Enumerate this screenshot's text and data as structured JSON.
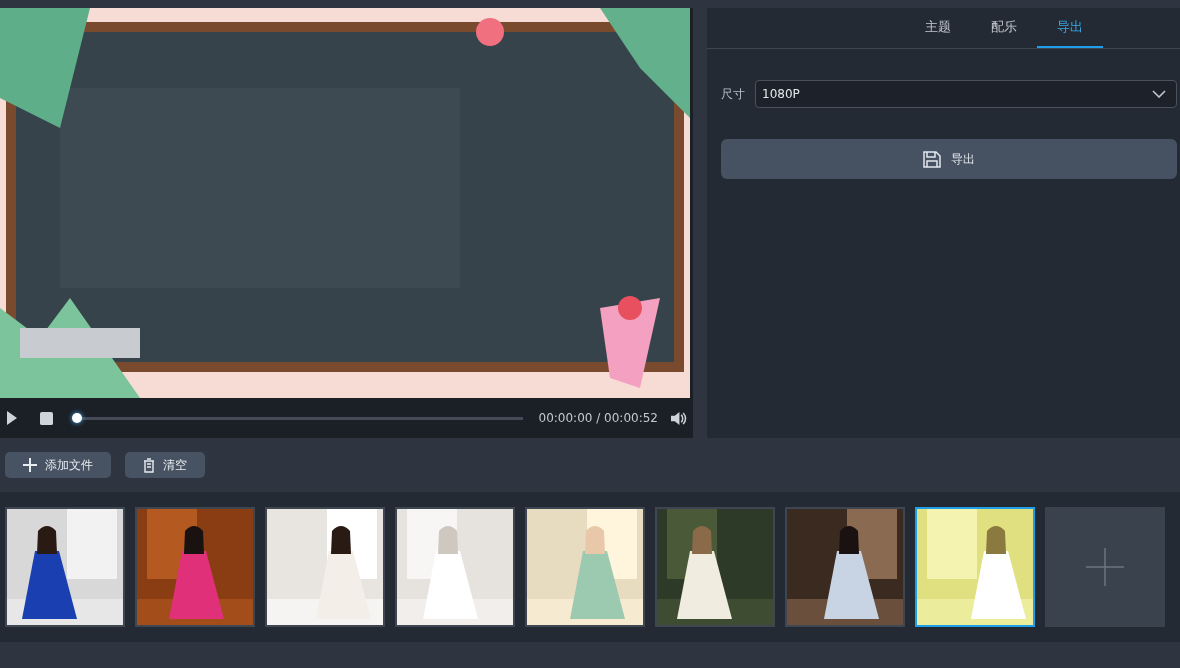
{
  "preview": {
    "kind": "picture"
  },
  "player": {
    "level": 0,
    "time": "00:00:00 / 00:00:52"
  },
  "tabs": [
    {
      "label": "主题",
      "selected": false
    },
    {
      "label": "配乐",
      "selected": false
    },
    {
      "label": "导出",
      "selected": true
    }
  ],
  "size": {
    "label": "尺寸",
    "value": "1080P"
  },
  "export_button": "导出",
  "toolbar": [
    {
      "kind": "add",
      "label": "添加文件"
    },
    {
      "kind": "clear",
      "label": "清空"
    }
  ],
  "thumbnails": [
    {
      "kind": "picture",
      "selected": false
    },
    {
      "kind": "picture",
      "selected": false
    },
    {
      "kind": "picture",
      "selected": false
    },
    {
      "kind": "picture",
      "selected": false
    },
    {
      "kind": "picture",
      "selected": false
    },
    {
      "kind": "picture",
      "selected": false
    },
    {
      "kind": "picture",
      "selected": false
    },
    {
      "kind": "picture",
      "selected": true
    },
    {
      "kind": "add"
    }
  ]
}
